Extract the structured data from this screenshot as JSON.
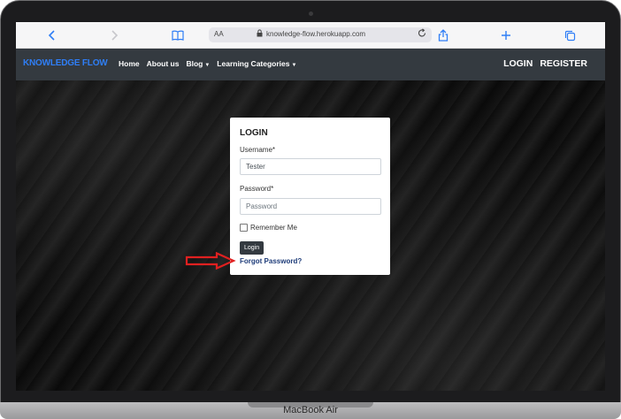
{
  "device": {
    "label": "MacBook Air"
  },
  "browser": {
    "text_size_label": "AA",
    "url": "knowledge-flow.herokuapp.com",
    "icons": [
      "back-icon",
      "forward-icon",
      "book-icon",
      "lock-icon",
      "reload-icon",
      "share-icon",
      "plus-icon",
      "tabs-icon"
    ]
  },
  "navbar": {
    "brand": "KNOWLEDGE FLOW",
    "brand_color": "#2f7ef6",
    "background": "#343a40",
    "links": [
      "Home",
      "About us",
      "Blog",
      "Learning Categories"
    ],
    "right_links": [
      "LOGIN",
      "REGISTER"
    ]
  },
  "login_form": {
    "title": "LOGIN",
    "username_label": "Username*",
    "username_value": "Tester",
    "password_label": "Password*",
    "password_placeholder": "Password",
    "remember_label": "Remember Me",
    "submit_label": "Login",
    "forgot_label": "Forgot Password?"
  },
  "annotation": {
    "arrow_color": "#e02020"
  }
}
